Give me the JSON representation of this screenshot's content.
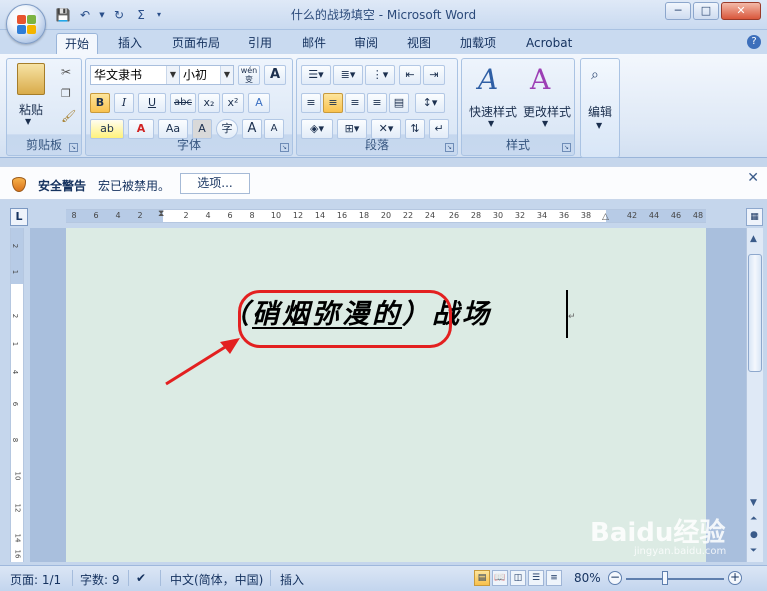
{
  "window": {
    "title": "什么的战场填空 - Microsoft Word",
    "controls": [
      "─",
      "□",
      "✕"
    ]
  },
  "quick_access": {
    "save_icon": "save-icon",
    "undo_icon": "undo-icon",
    "redo_icon": "redo-icon",
    "sum_label": "Σ"
  },
  "tabs": [
    "开始",
    "插入",
    "页面布局",
    "引用",
    "邮件",
    "审阅",
    "视图",
    "加载项",
    "Acrobat"
  ],
  "active_tab": "开始",
  "ribbon": {
    "clipboard": {
      "group_label": "剪贴板",
      "paste_label": "粘贴"
    },
    "font": {
      "group_label": "字体",
      "font_name": "华文隶书",
      "font_size": "小初",
      "wen_label": "wén\n变",
      "a_box": "A",
      "bold": "B",
      "italic": "I",
      "underline": "U",
      "strike": "abc",
      "subscript": "x₂",
      "superscript": "x²",
      "clear": "A",
      "highlight": "ab",
      "color": "A",
      "case": "Aa",
      "shade_a": "A",
      "circle": "字",
      "grow": "A",
      "shrink": "A"
    },
    "paragraph": {
      "group_label": "段落"
    },
    "styles": {
      "group_label": "样式",
      "quick_styles": "快速样式",
      "change_styles": "更改样式"
    },
    "editing": {
      "label": "编辑"
    }
  },
  "security": {
    "title": "安全警告",
    "message": "宏已被禁用。",
    "options_button": "选项..."
  },
  "ruler": {
    "corner": "L",
    "ticks": [
      "8",
      "6",
      "4",
      "2",
      "2",
      "4",
      "6",
      "8",
      "10",
      "12",
      "14",
      "16",
      "18",
      "20",
      "22",
      "24",
      "26",
      "28",
      "30",
      "32",
      "34",
      "36",
      "38",
      "42",
      "44",
      "46",
      "48"
    ],
    "vticks": [
      "2",
      "1",
      "2",
      "1",
      "4",
      "6",
      "8",
      "10",
      "12",
      "14",
      "16"
    ]
  },
  "document": {
    "open_paren": "（",
    "highlighted": "硝烟弥漫的",
    "close_paren": "）",
    "after": "战场"
  },
  "status": {
    "page": "页面: 1/1",
    "words": "字数: 9",
    "language": "中文(简体，中国)",
    "mode": "插入",
    "zoom": "80%"
  },
  "watermark": {
    "text": "Baidu经验",
    "sub": "jingyan.baidu.com"
  },
  "colors": {
    "accent_red": "#e32020",
    "page_bg": "#dcebe4",
    "ribbon_bg": "#dfe9f6"
  }
}
